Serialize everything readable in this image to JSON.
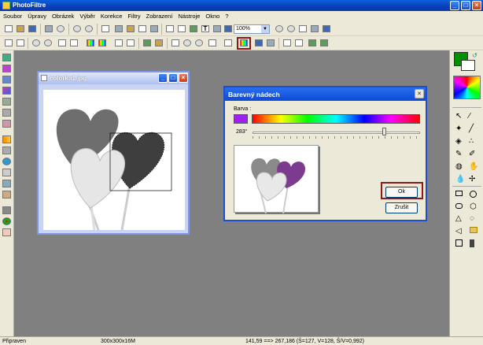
{
  "window": {
    "title": "PhotoFiltre"
  },
  "menu": [
    "Soubor",
    "Úpravy",
    "Obrázek",
    "Výběr",
    "Korekce",
    "Filtry",
    "Zobrazení",
    "Nástroje",
    "Okno",
    "?"
  ],
  "toolbar": {
    "zoom_value": "100%"
  },
  "image_window": {
    "title": "colorka1.jpg"
  },
  "dialog": {
    "title": "Barevný nádech",
    "color_label": "Barva :",
    "hue_value": "283°",
    "hue_fraction": 0.786,
    "swatch_color": "#a020f0",
    "ok_label": "Ok",
    "cancel_label": "Zrušit"
  },
  "status": {
    "state": "Připraven",
    "size": "300x300x16M",
    "coords": "141,59 ==> 267,186 (Š=127, V=128, Š/V=0,992)"
  },
  "colors": {
    "foreground": "#009000",
    "background": "#ffffff",
    "highlight": "#8b1a1a"
  }
}
